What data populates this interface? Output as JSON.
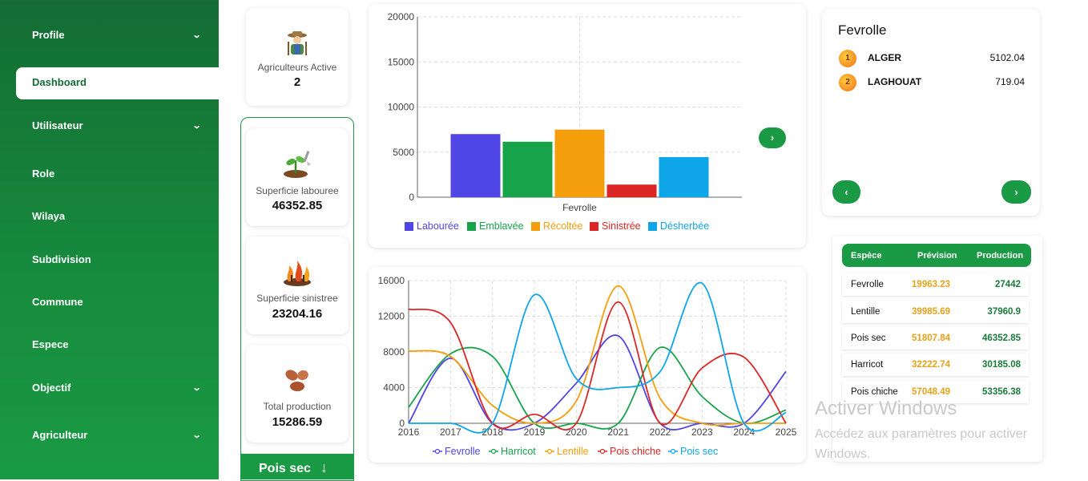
{
  "sidebar": {
    "items": [
      {
        "label": "Profile",
        "has_chevron": true
      },
      {
        "label": "Dashboard",
        "active": true
      },
      {
        "label": "Utilisateur",
        "has_chevron": true
      },
      {
        "label": "Role"
      },
      {
        "label": "Wilaya"
      },
      {
        "label": "Subdivision"
      },
      {
        "label": "Commune"
      },
      {
        "label": "Espece"
      },
      {
        "label": "Objectif",
        "has_chevron": true
      },
      {
        "label": "Agriculteur",
        "has_chevron": true
      }
    ]
  },
  "stats": {
    "agriculteurs": {
      "label": "Agriculteurs Active",
      "value": "2",
      "icon": "farmer-icon"
    },
    "superficie_labouree": {
      "label": "Superficie labouree",
      "value": "46352.85",
      "icon": "plant-seedling-icon"
    },
    "superficie_sinistree": {
      "label": "Superficie sinistree",
      "value": "23204.16",
      "icon": "wildfire-icon"
    },
    "total_production": {
      "label": "Total production",
      "value": "15286.59",
      "icon": "produce-icon"
    }
  },
  "species_button": {
    "label": "Pois sec",
    "icon": "arrow-down-icon"
  },
  "ranking": {
    "title": "Fevrolle",
    "rows": [
      {
        "rank": "1",
        "name": "ALGER",
        "value": "5102.04"
      },
      {
        "rank": "2",
        "name": "LAGHOUAT",
        "value": "719.04"
      }
    ]
  },
  "table": {
    "headers": {
      "espece": "Espèce",
      "prevision": "Prévision",
      "production": "Production"
    },
    "rows": [
      {
        "espece": "Fevrolle",
        "prevision": "19963.23",
        "production": "27442"
      },
      {
        "espece": "Lentille",
        "prevision": "39985.69",
        "production": "37960.9"
      },
      {
        "espece": "Pois sec",
        "prevision": "51807.84",
        "production": "46352.85"
      },
      {
        "espece": "Harricot",
        "prevision": "32222.74",
        "production": "30185.08"
      },
      {
        "espece": "Pois chiche",
        "prevision": "57048.49",
        "production": "53356.38"
      }
    ]
  },
  "watermark": {
    "title": "Activer Windows",
    "subtitle": "Accédez aux paramètres pour activer Windows."
  },
  "colors": {
    "sidebar_green": "#146c34",
    "accent_green": "#1b9a46",
    "prevision_orange": "#e5a21a"
  },
  "chart_data": [
    {
      "type": "bar",
      "categories": [
        "Fevrolle"
      ],
      "series": [
        {
          "name": "Labourée",
          "values": [
            7000
          ],
          "color": "#4f46e5"
        },
        {
          "name": "Emblavée",
          "values": [
            6150
          ],
          "color": "#16a34a"
        },
        {
          "name": "Récoltée",
          "values": [
            7500
          ],
          "color": "#f59e0b"
        },
        {
          "name": "Sinistrée",
          "values": [
            1400
          ],
          "color": "#dc2626"
        },
        {
          "name": "Désherbée",
          "values": [
            4450
          ],
          "color": "#0ea5e9"
        }
      ],
      "ylim": [
        0,
        20000
      ],
      "yticks": [
        "0",
        "5000",
        "10000",
        "15000",
        "20000"
      ],
      "grid": true,
      "legend": "bottom"
    },
    {
      "type": "line",
      "x": [
        2016,
        2017,
        2018,
        2019,
        2020,
        2021,
        2022,
        2023,
        2024,
        2025
      ],
      "xticks": [
        "2016",
        "2017",
        "2018",
        "2019",
        "2020",
        "2021",
        "2022",
        "2023",
        "2024",
        "2025"
      ],
      "series": [
        {
          "name": "Fevrolle",
          "values": [
            0,
            7300,
            0,
            0,
            4500,
            9800,
            0,
            0,
            0,
            5800
          ],
          "color": "#4f46e5"
        },
        {
          "name": "Harricot",
          "values": [
            1800,
            7800,
            7500,
            0,
            0,
            0,
            8500,
            3000,
            0,
            1500
          ],
          "color": "#16a34a"
        },
        {
          "name": "Lentille",
          "values": [
            8100,
            7500,
            2000,
            0,
            2500,
            15400,
            2800,
            0,
            0,
            0
          ],
          "color": "#f59e0b"
        },
        {
          "name": "Pois chiche",
          "values": [
            12800,
            11300,
            0,
            1000,
            0,
            13600,
            0,
            6200,
            7400,
            0
          ],
          "color": "#dc2626"
        },
        {
          "name": "Pois sec",
          "values": [
            0,
            0,
            0,
            14400,
            5000,
            4000,
            5800,
            15700,
            0,
            1200
          ],
          "color": "#0ea5e9"
        }
      ],
      "ylim": [
        0,
        16000
      ],
      "yticks": [
        "0",
        "4000",
        "8000",
        "12000",
        "16000"
      ],
      "grid": true,
      "legend": "bottom"
    }
  ]
}
